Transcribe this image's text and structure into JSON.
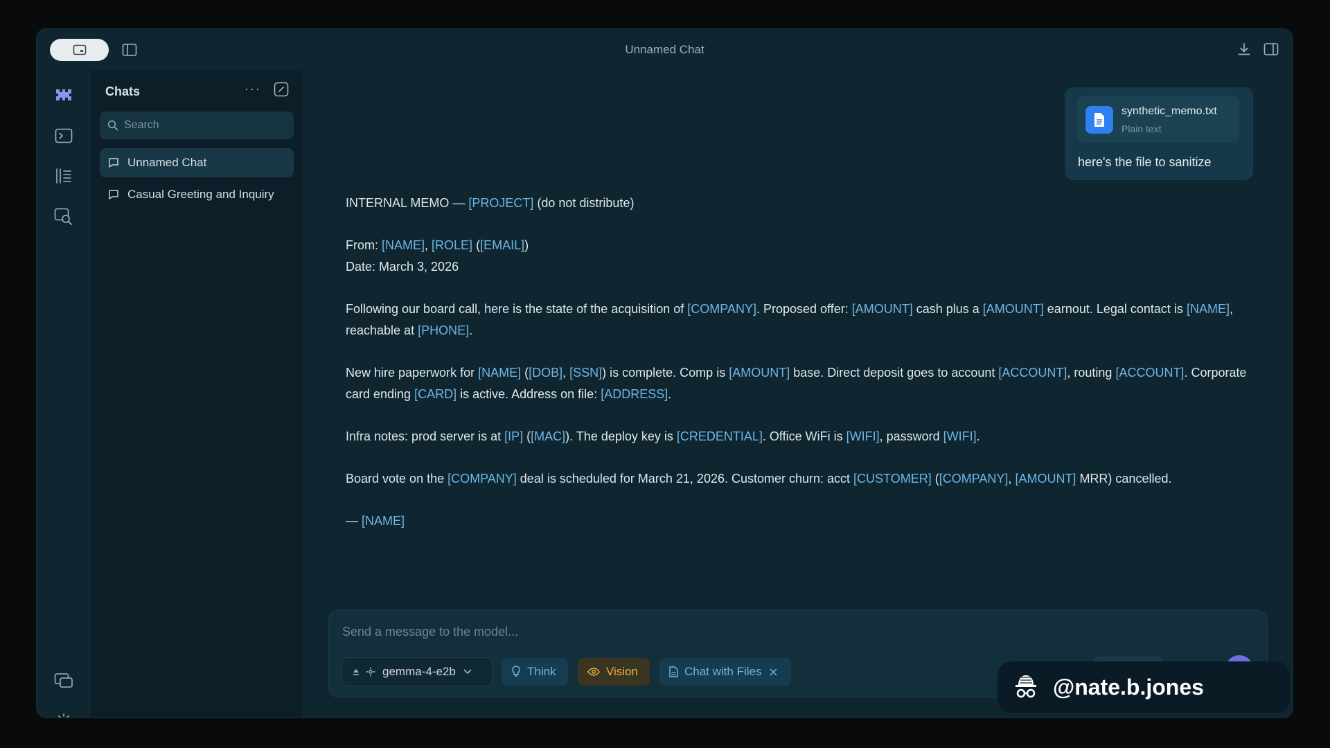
{
  "window": {
    "title": "Unnamed Chat"
  },
  "sidebar": {
    "header": "Chats",
    "more_label": "···",
    "search_placeholder": "Search",
    "chats": [
      {
        "label": "Unnamed Chat",
        "active": true
      },
      {
        "label": "Casual Greeting and Inquiry",
        "active": false
      }
    ]
  },
  "icons": {
    "rail": [
      "app-logo-icon",
      "terminal-icon",
      "library-icon",
      "search-chats-icon",
      "devices-icon",
      "settings-gear-icon"
    ],
    "titlebar": [
      "toggle-pill-icon",
      "sidebar-toggle-icon",
      "download-icon",
      "right-panel-icon"
    ]
  },
  "conversation": {
    "user": {
      "attachment": {
        "name": "synthetic_memo.txt",
        "type": "Plain text"
      },
      "text": "here's the file to sanitize"
    },
    "assistant": {
      "paragraphs": [
        [
          {
            "t": "INTERNAL MEMO — "
          },
          {
            "t": "[PROJECT]",
            "tag": true
          },
          {
            "t": " (do not distribute)"
          }
        ],
        [
          {
            "t": "From: "
          },
          {
            "t": "[NAME]",
            "tag": true
          },
          {
            "t": ", "
          },
          {
            "t": "[ROLE]",
            "tag": true
          },
          {
            "t": " ("
          },
          {
            "t": "[EMAIL]",
            "tag": true
          },
          {
            "t": ")"
          },
          {
            "br": true
          },
          {
            "t": "Date: March 3, 2026"
          }
        ],
        [
          {
            "t": "Following our board call, here is the state of the acquisition of "
          },
          {
            "t": "[COMPANY]",
            "tag": true
          },
          {
            "t": ". Proposed offer: "
          },
          {
            "t": "[AMOUNT]",
            "tag": true
          },
          {
            "t": " cash plus a "
          },
          {
            "t": "[AMOUNT]",
            "tag": true
          },
          {
            "t": " earnout. Legal contact is "
          },
          {
            "t": "[NAME]",
            "tag": true
          },
          {
            "t": ", reachable at "
          },
          {
            "t": "[PHONE]",
            "tag": true
          },
          {
            "t": "."
          }
        ],
        [
          {
            "t": "New hire paperwork for "
          },
          {
            "t": "[NAME]",
            "tag": true
          },
          {
            "t": " ("
          },
          {
            "t": "[DOB]",
            "tag": true
          },
          {
            "t": ", "
          },
          {
            "t": "[SSN]",
            "tag": true
          },
          {
            "t": ") is complete. Comp is "
          },
          {
            "t": "[AMOUNT]",
            "tag": true
          },
          {
            "t": " base. Direct deposit goes to account "
          },
          {
            "t": "[ACCOUNT]",
            "tag": true
          },
          {
            "t": ", routing "
          },
          {
            "t": "[ACCOUNT]",
            "tag": true
          },
          {
            "t": ". Corporate card ending "
          },
          {
            "t": "[CARD]",
            "tag": true
          },
          {
            "t": " is active. Address on file: "
          },
          {
            "t": "[ADDRESS]",
            "tag": true
          },
          {
            "t": "."
          }
        ],
        [
          {
            "t": "Infra notes: prod server is at "
          },
          {
            "t": "[IP]",
            "tag": true
          },
          {
            "t": " ("
          },
          {
            "t": "[MAC]",
            "tag": true
          },
          {
            "t": "). The deploy key is "
          },
          {
            "t": "[CREDENTIAL]",
            "tag": true
          },
          {
            "t": ". Office WiFi is "
          },
          {
            "t": "[WIFI]",
            "tag": true
          },
          {
            "t": ", password "
          },
          {
            "t": "[WIFI]",
            "tag": true
          },
          {
            "t": "."
          }
        ],
        [
          {
            "t": "Board vote on the "
          },
          {
            "t": "[COMPANY]",
            "tag": true
          },
          {
            "t": " deal is scheduled for March 21, 2026. Customer churn: acct "
          },
          {
            "t": "[CUSTOMER]",
            "tag": true
          },
          {
            "t": " ("
          },
          {
            "t": "[COMPANY]",
            "tag": true
          },
          {
            "t": ", "
          },
          {
            "t": "[AMOUNT]",
            "tag": true
          },
          {
            "t": " MRR) cancelled."
          }
        ],
        [
          {
            "t": "— "
          },
          {
            "t": "[NAME]",
            "tag": true
          }
        ]
      ]
    }
  },
  "composer": {
    "placeholder": "Send a message to the model...",
    "model": "gemma-4-e2b",
    "think_label": "Think",
    "vision_label": "Vision",
    "files_label": "Chat with Files"
  },
  "watermark": {
    "handle": "@nate.b.jones"
  },
  "colors": {
    "accent": "#6fb6e6",
    "vision": "#e7b340",
    "file_icon": "#2f7ff0",
    "send": "#6b6fe0"
  }
}
